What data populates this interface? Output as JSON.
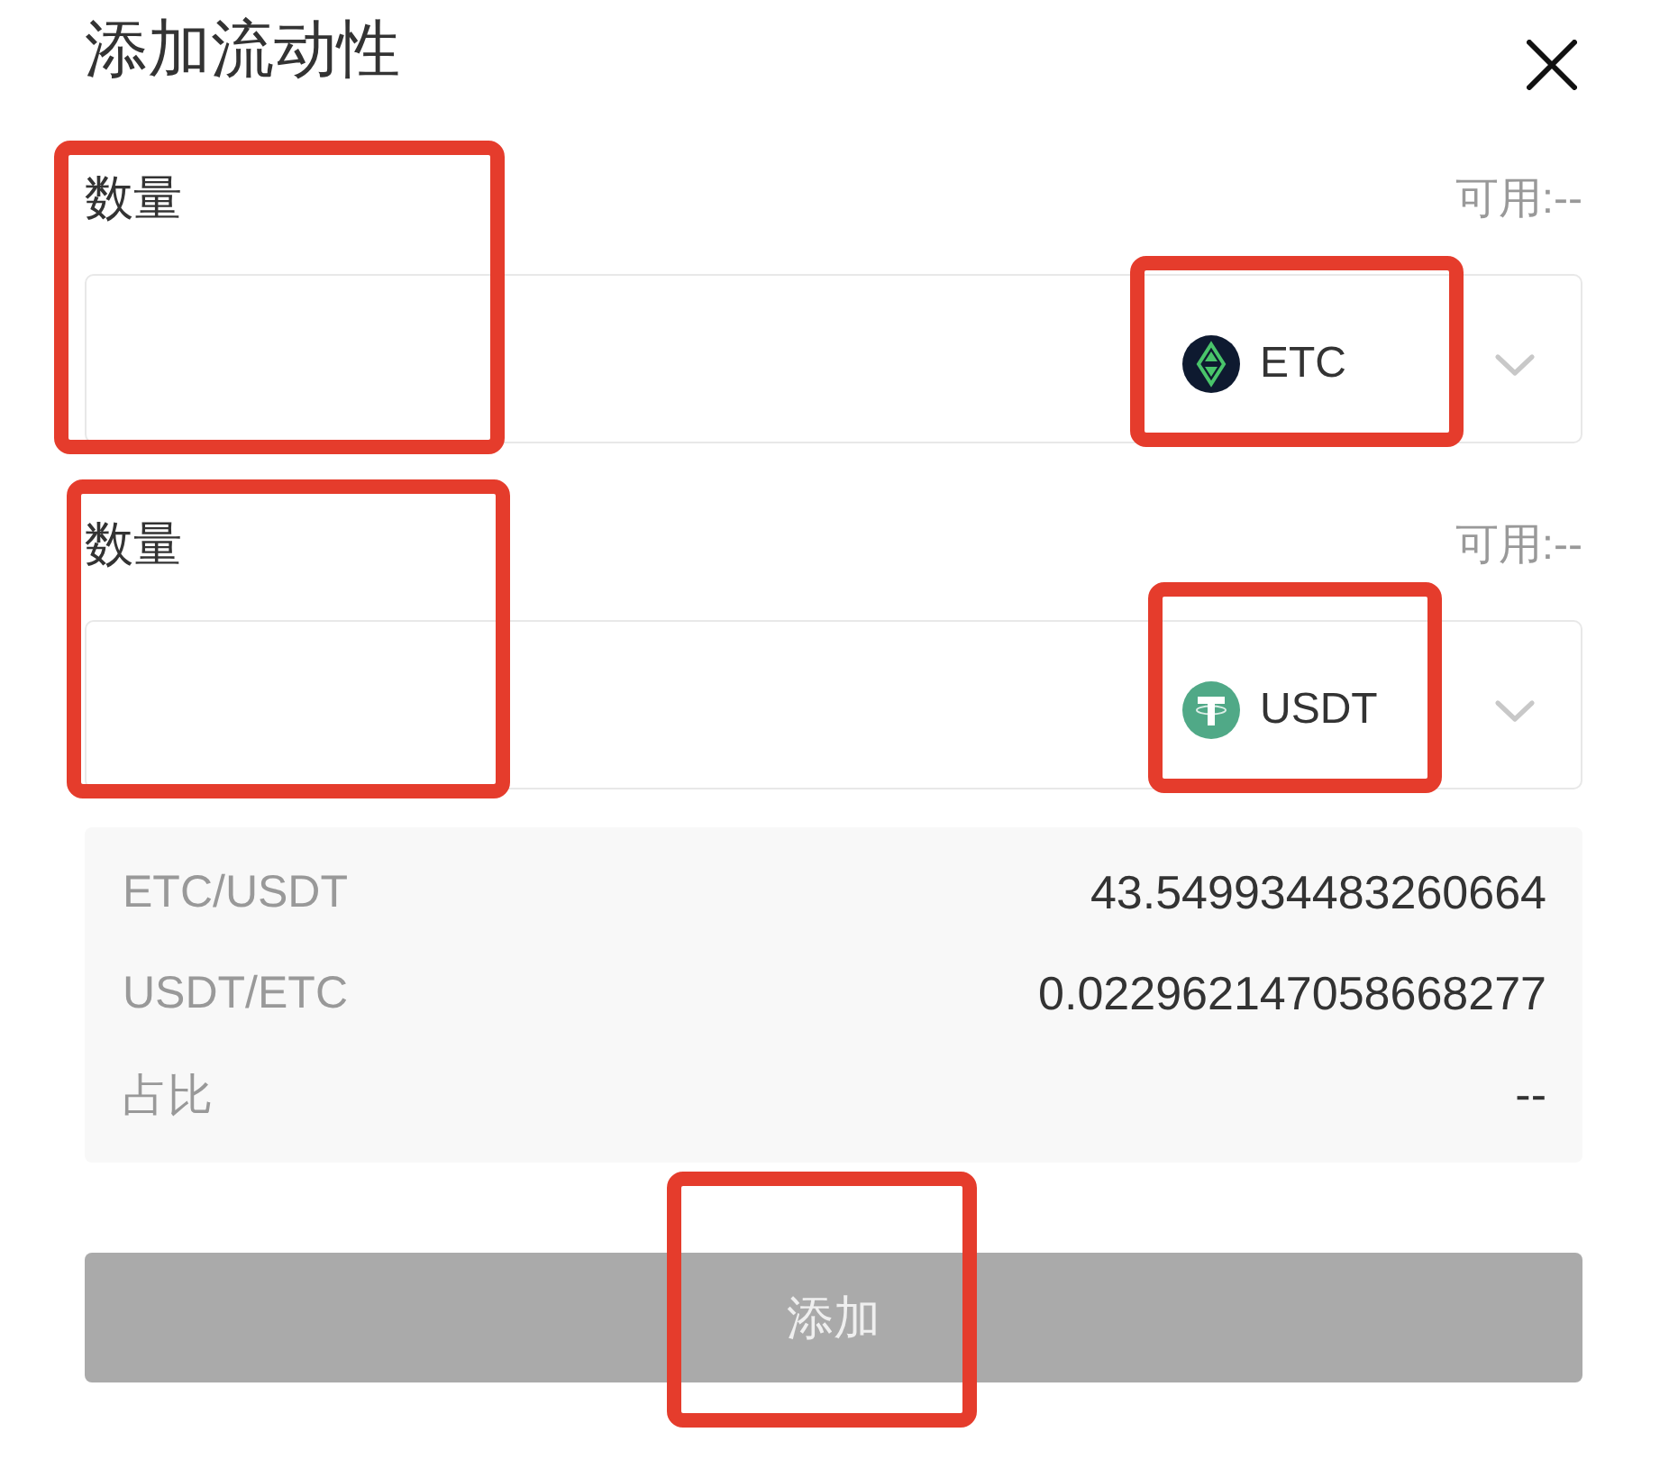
{
  "dialog": {
    "title": "添加流动性"
  },
  "fields": [
    {
      "label": "数量",
      "available": "可用:--",
      "label_marked": true,
      "token": {
        "symbol": "ETC",
        "kind": "diamond",
        "marked": true
      }
    },
    {
      "label": "数量",
      "available": "可用:--",
      "label_marked": true,
      "token": {
        "symbol": "USDT",
        "kind": "tee",
        "marked": true
      }
    }
  ],
  "info": {
    "rows": [
      {
        "label": "ETC/USDT",
        "value": "43.549934483260664"
      },
      {
        "label": "USDT/ETC",
        "value": "0.022962147058668277"
      },
      {
        "label": "占比",
        "value": "--"
      }
    ]
  },
  "submit": {
    "label": "添加",
    "disabled": true,
    "marked": true
  }
}
